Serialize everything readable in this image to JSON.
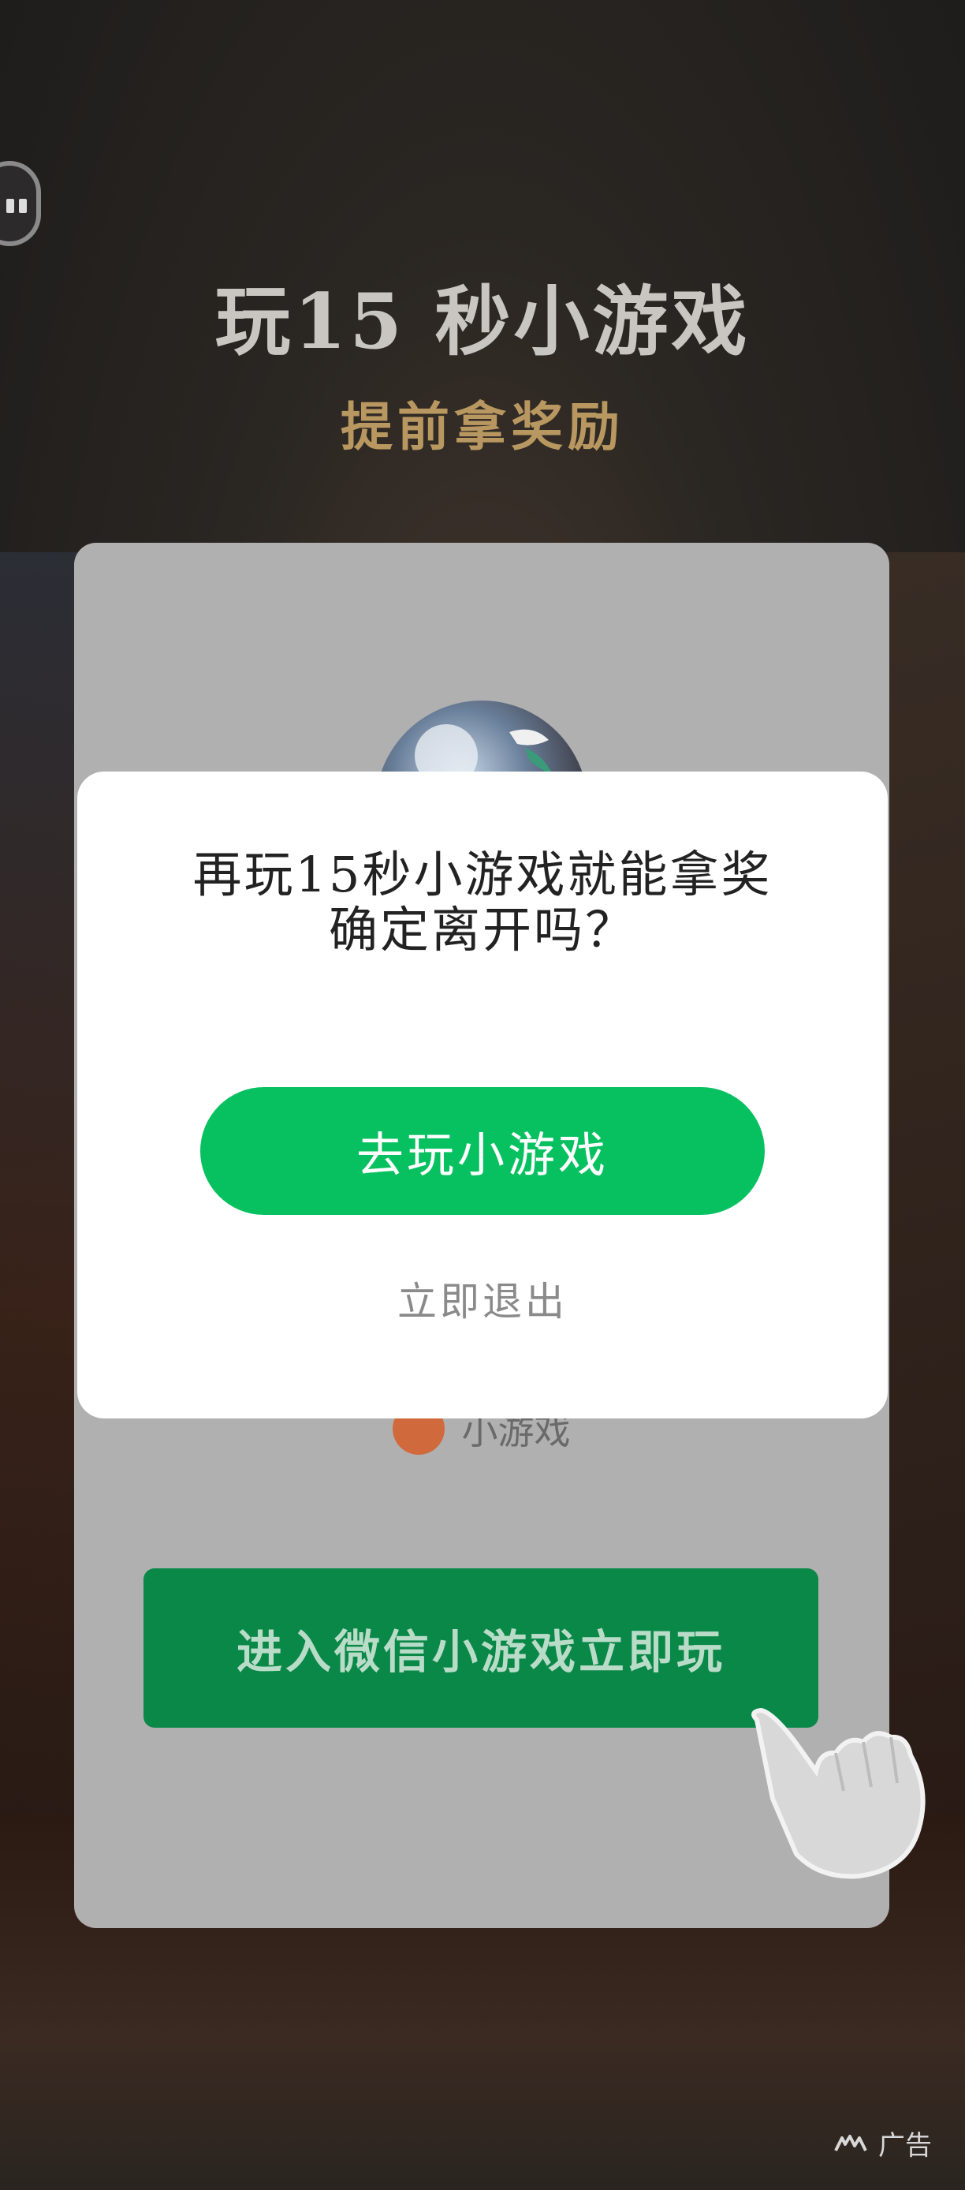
{
  "headline": "玩15 秒小游戏",
  "subline": "提前拿奖励",
  "card": {
    "brand_name": "小游戏",
    "enter_button": "进入微信小游戏立即玩"
  },
  "dialog": {
    "line1": "再玩15秒小游戏就能拿奖",
    "line2": "确定离开吗？",
    "play_button": "去玩小游戏",
    "exit_link": "立即退出"
  },
  "ad_label": "广告",
  "colors": {
    "primary_green": "#07c160",
    "enter_green": "#098848",
    "gold": "#b89860"
  }
}
